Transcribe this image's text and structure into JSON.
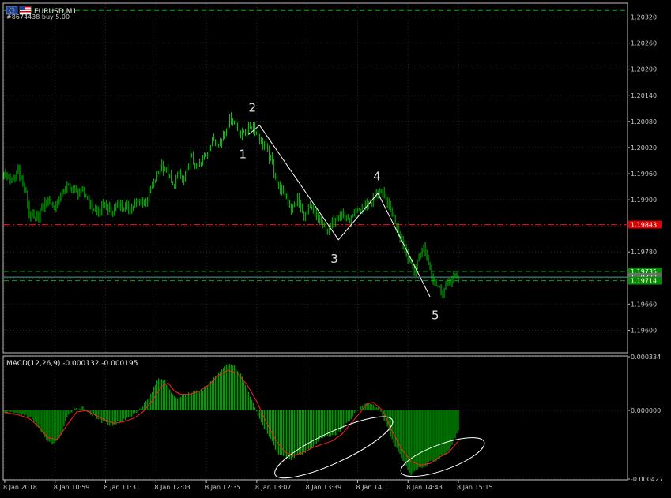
{
  "window": {
    "symbol_title": "EURUSD,M1",
    "trade_label": "#8674438 buy 5.00"
  },
  "indicator": {
    "title": "MACD(12,26,9) -0.000132 -0.000195"
  },
  "colors": {
    "background": "#000000",
    "frame": "#c0c0c0",
    "grid": "#4a4a4a",
    "candle": "#00c800",
    "zigzag": "#ffffff",
    "tp_line": "#00b000",
    "sl_line": "#ff0000",
    "bid_line": "#5a9a9a",
    "macd_hist": "#00a000",
    "macd_signal": "#ff2020",
    "ellipse": "#ffffff"
  },
  "chart_data": [
    {
      "type": "line",
      "ylim": [
        1.1955,
        1.2035
      ],
      "y_ticks": [
        1.196,
        1.1966,
        1.1972,
        1.1978,
        1.1984,
        1.199,
        1.1996,
        1.2002,
        1.2008,
        1.2014,
        1.202,
        1.2026,
        1.2032
      ],
      "y_tick_labels": [
        "1.19600",
        "1.19660",
        "",
        "1.19780",
        "",
        "1.19900",
        "1.19960",
        "1.20020",
        "1.20080",
        "1.20140",
        "1.20200",
        "1.20260",
        "1.20320"
      ],
      "x_tick_labels": [
        "8 Jan 2018",
        "8 Jan 10:59",
        "8 Jan 11:31",
        "8 Jan 12:03",
        "8 Jan 12:35",
        "8 Jan 13:07",
        "8 Jan 13:39",
        "8 Jan 14:11",
        "8 Jan 14:43",
        "8 Jan 15:15"
      ],
      "x_range": [
        0,
        288
      ],
      "close_points": [
        [
          0,
          1.1996
        ],
        [
          6,
          1.1994
        ],
        [
          9,
          1.1997
        ],
        [
          14,
          1.1991
        ],
        [
          16,
          1.1987
        ],
        [
          20,
          1.1985
        ],
        [
          24,
          1.1988
        ],
        [
          28,
          1.199
        ],
        [
          32,
          1.1988
        ],
        [
          36,
          1.1991
        ],
        [
          40,
          1.1993
        ],
        [
          46,
          1.1992
        ],
        [
          52,
          1.1991
        ],
        [
          56,
          1.1988
        ],
        [
          60,
          1.1987
        ],
        [
          64,
          1.1989
        ],
        [
          68,
          1.1987
        ],
        [
          72,
          1.1989
        ],
        [
          78,
          1.1988
        ],
        [
          84,
          1.1989
        ],
        [
          90,
          1.199
        ],
        [
          95,
          1.1994
        ],
        [
          100,
          1.1998
        ],
        [
          104,
          1.1996
        ],
        [
          107,
          1.1993
        ],
        [
          111,
          1.1996
        ],
        [
          114,
          1.1994
        ],
        [
          118,
          1.2
        ],
        [
          122,
          1.1997
        ],
        [
          126,
          1.1999
        ],
        [
          130,
          1.2002
        ],
        [
          133,
          1.2004
        ],
        [
          137,
          1.2003
        ],
        [
          141,
          1.2007
        ],
        [
          144,
          1.2009
        ],
        [
          147,
          1.2007
        ],
        [
          150,
          1.2005
        ],
        [
          154,
          1.2006
        ],
        [
          158,
          1.2007
        ],
        [
          162,
          1.2004
        ],
        [
          166,
          1.2002
        ],
        [
          170,
          1.1998
        ],
        [
          174,
          1.1993
        ],
        [
          178,
          1.1991
        ],
        [
          182,
          1.1988
        ],
        [
          186,
          1.199
        ],
        [
          190,
          1.1986
        ],
        [
          194,
          1.1988
        ],
        [
          198,
          1.1986
        ],
        [
          202,
          1.1984
        ],
        [
          206,
          1.1983
        ],
        [
          210,
          1.1986
        ],
        [
          214,
          1.1987
        ],
        [
          218,
          1.1985
        ],
        [
          222,
          1.1986
        ],
        [
          226,
          1.1988
        ],
        [
          230,
          1.1989
        ],
        [
          234,
          1.199
        ],
        [
          238,
          1.1992
        ],
        [
          242,
          1.199
        ],
        [
          246,
          1.1987
        ],
        [
          250,
          1.1983
        ],
        [
          254,
          1.1979
        ],
        [
          257,
          1.1976
        ],
        [
          260,
          1.1973
        ],
        [
          263,
          1.1977
        ],
        [
          266,
          1.1979
        ],
        [
          269,
          1.1976
        ],
        [
          272,
          1.1972
        ],
        [
          275,
          1.197
        ],
        [
          278,
          1.1969
        ],
        [
          281,
          1.1971
        ],
        [
          284,
          1.1972
        ],
        [
          288,
          1.1972
        ]
      ],
      "zigzag": [
        [
          155,
          1.2005
        ],
        [
          162,
          1.20071
        ],
        [
          212,
          1.19808
        ],
        [
          237,
          1.19915
        ],
        [
          270,
          1.19677
        ]
      ],
      "wave_labels": [
        {
          "x": 149,
          "y": 1.19995,
          "text": "1"
        },
        {
          "x": 155,
          "y": 1.20102,
          "text": "2"
        },
        {
          "x": 207,
          "y": 1.19755,
          "text": "3"
        },
        {
          "x": 234,
          "y": 1.19945,
          "text": "4"
        },
        {
          "x": 271,
          "y": 1.19625,
          "text": "5"
        }
      ],
      "levels": [
        {
          "name": "tp",
          "value": 1.20335,
          "label": "",
          "style": "dash-green"
        },
        {
          "name": "sl",
          "value": 1.19843,
          "label": "1.19843",
          "style": "dashdot-red"
        },
        {
          "name": "open-upper",
          "value": 1.19735,
          "label": "1.19735",
          "style": "dash-green"
        },
        {
          "name": "bid",
          "value": 1.19722,
          "label": "1.19722",
          "style": "solid-gray"
        },
        {
          "name": "open-lower",
          "value": 1.19714,
          "label": "1.19714",
          "style": "dash-green"
        }
      ]
    },
    {
      "type": "bar",
      "ylim": [
        -0.000427,
        0.000334
      ],
      "y_tick_labels": [
        "0.000334",
        "0.000000",
        "-0.000427"
      ],
      "y_ticks": [
        0.000334,
        0.0,
        -0.000427
      ],
      "x_range": [
        0,
        288
      ],
      "histogram_points": [
        [
          0,
          -1e-05
        ],
        [
          10,
          -2e-05
        ],
        [
          16,
          -4e-05
        ],
        [
          20,
          -8e-05
        ],
        [
          24,
          -0.00014
        ],
        [
          28,
          -0.0002
        ],
        [
          32,
          -0.00021
        ],
        [
          36,
          -0.00015
        ],
        [
          40,
          -5e-05
        ],
        [
          44,
          1e-05
        ],
        [
          50,
          2e-05
        ],
        [
          56,
          -3e-05
        ],
        [
          62,
          -7e-05
        ],
        [
          68,
          -9e-05
        ],
        [
          74,
          -7e-05
        ],
        [
          80,
          -4e-05
        ],
        [
          86,
          1e-05
        ],
        [
          92,
          8e-05
        ],
        [
          98,
          0.0002
        ],
        [
          102,
          0.00019
        ],
        [
          106,
          0.0001
        ],
        [
          110,
          8e-05
        ],
        [
          114,
          0.0001
        ],
        [
          120,
          0.00011
        ],
        [
          126,
          0.00013
        ],
        [
          132,
          0.00019
        ],
        [
          138,
          0.00026
        ],
        [
          142,
          0.00029
        ],
        [
          146,
          0.00028
        ],
        [
          150,
          0.00023
        ],
        [
          154,
          0.00013
        ],
        [
          158,
          5e-05
        ],
        [
          162,
          -6e-05
        ],
        [
          166,
          -0.00013
        ],
        [
          170,
          -0.0002
        ],
        [
          174,
          -0.00027
        ],
        [
          178,
          -0.00029
        ],
        [
          182,
          -0.0003
        ],
        [
          186,
          -0.00028
        ],
        [
          190,
          -0.00027
        ],
        [
          194,
          -0.00024
        ],
        [
          198,
          -0.0002
        ],
        [
          202,
          -0.00017
        ],
        [
          206,
          -0.00016
        ],
        [
          210,
          -0.00015
        ],
        [
          214,
          -0.00012
        ],
        [
          218,
          -7e-05
        ],
        [
          222,
          -2e-05
        ],
        [
          226,
          2e-05
        ],
        [
          230,
          5e-05
        ],
        [
          234,
          4e-05
        ],
        [
          238,
          1e-05
        ],
        [
          242,
          -8e-05
        ],
        [
          246,
          -0.00018
        ],
        [
          250,
          -0.00026
        ],
        [
          254,
          -0.00033
        ],
        [
          258,
          -0.0004
        ],
        [
          262,
          -0.00036
        ],
        [
          266,
          -0.00036
        ],
        [
          270,
          -0.00032
        ],
        [
          274,
          -0.00031
        ],
        [
          278,
          -0.00028
        ],
        [
          282,
          -0.00025
        ],
        [
          288,
          -0.00013
        ]
      ],
      "signal_points": [
        [
          0,
          -1e-05
        ],
        [
          10,
          -3e-05
        ],
        [
          16,
          -5e-05
        ],
        [
          22,
          -0.0001
        ],
        [
          28,
          -0.00017
        ],
        [
          34,
          -0.00018
        ],
        [
          40,
          -9e-05
        ],
        [
          46,
          -1e-05
        ],
        [
          52,
          0.0
        ],
        [
          58,
          -3e-05
        ],
        [
          64,
          -6e-05
        ],
        [
          70,
          -8e-05
        ],
        [
          76,
          -7e-05
        ],
        [
          82,
          -5e-05
        ],
        [
          88,
          -1e-05
        ],
        [
          94,
          6e-05
        ],
        [
          100,
          0.00015
        ],
        [
          104,
          0.00017
        ],
        [
          108,
          0.00012
        ],
        [
          112,
          0.0001
        ],
        [
          118,
          0.0001
        ],
        [
          124,
          0.00012
        ],
        [
          130,
          0.00016
        ],
        [
          136,
          0.00022
        ],
        [
          142,
          0.00025
        ],
        [
          148,
          0.00023
        ],
        [
          154,
          0.00016
        ],
        [
          160,
          6e-05
        ],
        [
          166,
          -7e-05
        ],
        [
          172,
          -0.00018
        ],
        [
          178,
          -0.00026
        ],
        [
          184,
          -0.00028
        ],
        [
          190,
          -0.00026
        ],
        [
          196,
          -0.00023
        ],
        [
          202,
          -0.00021
        ],
        [
          208,
          -0.00019
        ],
        [
          214,
          -0.00015
        ],
        [
          220,
          -8e-05
        ],
        [
          226,
          -1e-05
        ],
        [
          230,
          4e-05
        ],
        [
          234,
          5e-05
        ],
        [
          240,
          0.0
        ],
        [
          246,
          -0.00013
        ],
        [
          252,
          -0.00024
        ],
        [
          258,
          -0.00032
        ],
        [
          264,
          -0.00034
        ],
        [
          270,
          -0.00033
        ],
        [
          276,
          -0.00029
        ],
        [
          282,
          -0.00026
        ],
        [
          288,
          -0.00019
        ]
      ],
      "ellipses": [
        {
          "cx": 209,
          "cy": -0.00023,
          "rx": 41,
          "ry": 9.5e-05,
          "angle": -25
        },
        {
          "cx": 278,
          "cy": -0.00029,
          "rx": 28,
          "ry": 8e-05,
          "angle": -20
        }
      ]
    }
  ]
}
